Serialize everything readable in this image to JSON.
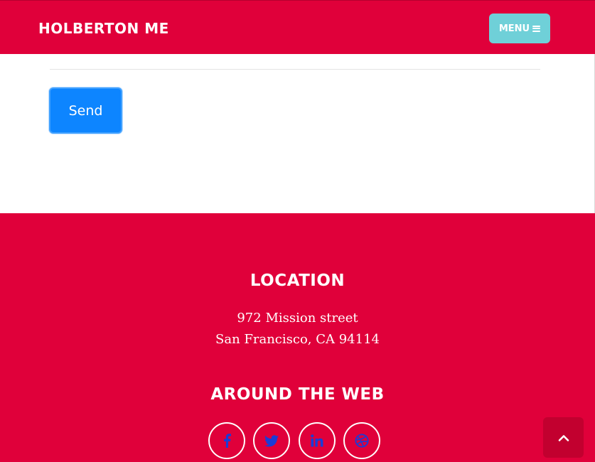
{
  "navbar": {
    "brand": "HOLBERTON ME",
    "menu_label": "MENU",
    "menu_icon": "bars-icon"
  },
  "contact_form": {
    "send_label": "Send"
  },
  "footer": {
    "location": {
      "title": "LOCATION",
      "address_line1": "972 Mission street",
      "address_line2": "San Francisco, CA 94114"
    },
    "around_the_web": {
      "title": "AROUND THE WEB",
      "social_icons": [
        "facebook-icon",
        "twitter-icon",
        "linkedin-icon",
        "dribbble-icon"
      ]
    }
  },
  "scroll_top": {
    "icon": "chevron-up-icon"
  },
  "colors": {
    "brand_red": "#e0003a",
    "menu_teal": "#6fd0d8",
    "send_blue": "#0d85ff",
    "social_icon_blue": "#1a3cd6",
    "scroll_top_bg": "#c2002f"
  }
}
